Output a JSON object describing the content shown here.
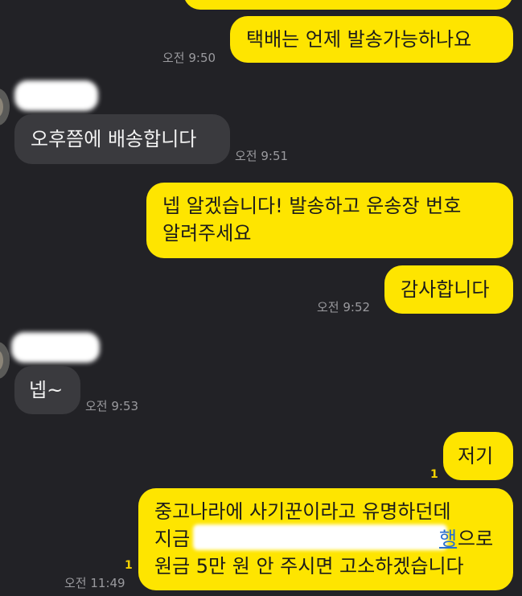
{
  "messages": [
    {
      "id": "m1",
      "sender": "me",
      "lines": [
        "택배는 언제 발송가능하나요"
      ],
      "time": "오전 9:50"
    },
    {
      "id": "m2",
      "sender": "other",
      "lines": [
        "오후쯤에 배송합니다"
      ],
      "time": "오전 9:51"
    },
    {
      "id": "m3",
      "sender": "me",
      "lines": [
        "넵 알겠습니다! 발송하고 운송장 번호",
        "알려주세요"
      ]
    },
    {
      "id": "m4",
      "sender": "me",
      "lines": [
        "감사합니다"
      ],
      "time": "오전 9:52"
    },
    {
      "id": "m5",
      "sender": "other",
      "lines": [
        "넵~"
      ],
      "time": "오전 9:53"
    },
    {
      "id": "m6",
      "sender": "me",
      "lines": [
        "저기"
      ],
      "unread": "1"
    },
    {
      "id": "m7",
      "sender": "me",
      "lines": [
        "중고나라에 사기꾼이라고 유명하던데",
        "지금",
        "원금 5만 원 안 주시면 고소하겠습니다"
      ],
      "line2_suffix": "으로",
      "line2_link_fragment": "행",
      "unread": "1",
      "time": "오전 11:49"
    }
  ],
  "colors": {
    "background": "#222226",
    "outgoing_bubble": "#fee500",
    "incoming_bubble": "#3a3a3e",
    "unread": "#f5d200"
  }
}
